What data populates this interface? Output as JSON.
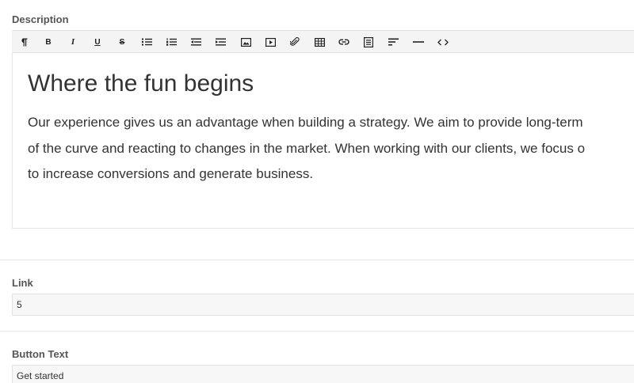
{
  "description": {
    "label": "Description",
    "toolbar": [
      {
        "name": "paragraph-icon",
        "glyph": "¶"
      },
      {
        "name": "bold-icon",
        "glyph": "B"
      },
      {
        "name": "italic-icon",
        "glyph": "I"
      },
      {
        "name": "underline-icon",
        "glyph": "U"
      },
      {
        "name": "strikethrough-icon",
        "glyph": "S"
      },
      {
        "name": "unordered-list-icon"
      },
      {
        "name": "ordered-list-icon"
      },
      {
        "name": "outdent-icon"
      },
      {
        "name": "indent-icon"
      },
      {
        "name": "image-icon"
      },
      {
        "name": "video-icon"
      },
      {
        "name": "attachment-icon"
      },
      {
        "name": "table-icon"
      },
      {
        "name": "link-icon"
      },
      {
        "name": "align-center-icon"
      },
      {
        "name": "align-left-icon"
      },
      {
        "name": "horizontal-rule-icon"
      },
      {
        "name": "code-view-icon"
      }
    ],
    "content": {
      "heading": "Where the fun begins",
      "lines": [
        "Our experience gives us an advantage when building a strategy. We aim to provide long-term",
        "of the curve and reacting to changes in the market. When working with our clients, we focus o",
        "to increase conversions and generate business."
      ]
    }
  },
  "link": {
    "label": "Link",
    "value": "5"
  },
  "button_text": {
    "label": "Button Text",
    "value": "Get started"
  }
}
